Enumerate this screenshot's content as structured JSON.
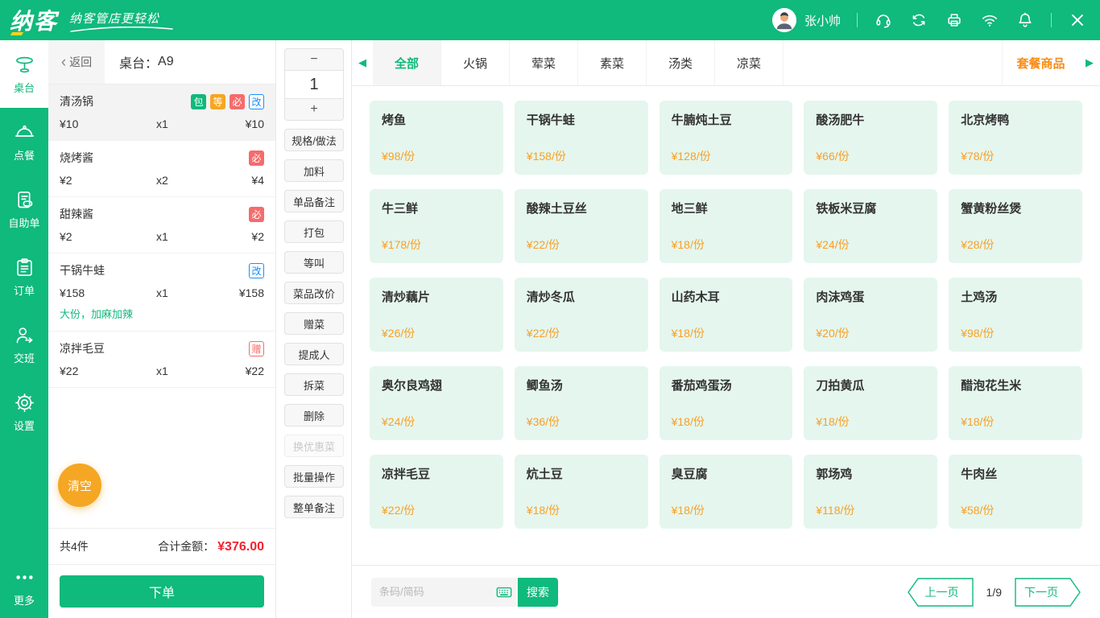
{
  "colors": {
    "theme_green": "#10b97c",
    "accent_orange": "#f5a623",
    "price_orange": "#f9a026",
    "danger_red": "#f5222d",
    "combo_orange": "#fa8c16",
    "badge_blue": "#1890ff",
    "badge_red": "#f56c6c"
  },
  "topbar": {
    "logo": "纳客",
    "slogan": "纳客管店更轻松",
    "user": "张小帅",
    "icons": [
      "avatar",
      "headset-icon",
      "sync-icon",
      "printer-icon",
      "wifi-icon",
      "bell-icon",
      "close-icon"
    ]
  },
  "sidebar": {
    "items": [
      {
        "label": "桌台",
        "icon": "table-icon",
        "active": true
      },
      {
        "label": "点餐",
        "icon": "cloche-icon"
      },
      {
        "label": "自助单",
        "icon": "self-order-icon"
      },
      {
        "label": "订单",
        "icon": "clipboard-icon"
      },
      {
        "label": "交班",
        "icon": "shift-person-icon"
      },
      {
        "label": "设置",
        "icon": "gear-icon"
      }
    ],
    "more": "更多"
  },
  "order": {
    "back": "返回",
    "table_prefix": "桌台：",
    "table_no": "A9",
    "items": [
      {
        "name": "清汤锅",
        "price": "¥10",
        "qty": "x1",
        "total": "¥10",
        "badges": [
          "包",
          "等",
          "必",
          "改"
        ],
        "selected": true
      },
      {
        "name": "烧烤酱",
        "price": "¥2",
        "qty": "x2",
        "total": "¥4",
        "badges": [
          "必"
        ]
      },
      {
        "name": "甜辣酱",
        "price": "¥2",
        "qty": "x1",
        "total": "¥2",
        "badges": [
          "必"
        ]
      },
      {
        "name": "干锅牛蛙",
        "price": "¥158",
        "qty": "x1",
        "total": "¥158",
        "badges": [
          "改"
        ],
        "note": "大份，加麻加辣"
      },
      {
        "name": "凉拌毛豆",
        "price": "¥22",
        "qty": "x1",
        "total": "¥22",
        "badges": [
          "赠"
        ]
      }
    ],
    "clear": "清空",
    "count": "共4件",
    "total_label": "合计金额：",
    "total_value": "¥376.00",
    "submit": "下单"
  },
  "actions": {
    "minus": "−",
    "qty": "1",
    "plus": "+",
    "buttons": [
      {
        "label": "规格/做法"
      },
      {
        "label": "加料"
      },
      {
        "label": "单品备注"
      },
      {
        "label": "打包"
      },
      {
        "label": "等叫"
      },
      {
        "label": "菜品改价"
      },
      {
        "label": "赠菜"
      },
      {
        "label": "提成人"
      },
      {
        "label": "拆菜"
      },
      {
        "label": "删除"
      },
      {
        "label": "换优惠菜",
        "disabled": true
      },
      {
        "label": "批量操作"
      },
      {
        "label": "整单备注"
      }
    ]
  },
  "categories": {
    "tabs": [
      {
        "label": "全部",
        "active": true
      },
      {
        "label": "火锅"
      },
      {
        "label": "荤菜"
      },
      {
        "label": "素菜"
      },
      {
        "label": "汤类"
      },
      {
        "label": "凉菜"
      }
    ],
    "combo": "套餐商品"
  },
  "menu": {
    "items": [
      {
        "name": "烤鱼",
        "price": "¥98/份"
      },
      {
        "name": "干锅牛蛙",
        "price": "¥158/份"
      },
      {
        "name": "牛腩炖土豆",
        "price": "¥128/份"
      },
      {
        "name": "酸汤肥牛",
        "price": "¥66/份"
      },
      {
        "name": "北京烤鸭",
        "price": "¥78/份"
      },
      {
        "name": "牛三鲜",
        "price": "¥178/份"
      },
      {
        "name": "酸辣土豆丝",
        "price": "¥22/份"
      },
      {
        "name": "地三鲜",
        "price": "¥18/份"
      },
      {
        "name": "铁板米豆腐",
        "price": "¥24/份"
      },
      {
        "name": "蟹黄粉丝煲",
        "price": "¥28/份"
      },
      {
        "name": "清炒藕片",
        "price": "¥26/份"
      },
      {
        "name": "清炒冬瓜",
        "price": "¥22/份"
      },
      {
        "name": "山药木耳",
        "price": "¥18/份"
      },
      {
        "name": "肉沫鸡蛋",
        "price": "¥20/份"
      },
      {
        "name": "土鸡汤",
        "price": "¥98/份"
      },
      {
        "name": "奥尔良鸡翅",
        "price": "¥24/份"
      },
      {
        "name": "鲫鱼汤",
        "price": "¥36/份"
      },
      {
        "name": "番茄鸡蛋汤",
        "price": "¥18/份"
      },
      {
        "name": "刀拍黄瓜",
        "price": "¥18/份"
      },
      {
        "name": "醋泡花生米",
        "price": "¥18/份"
      },
      {
        "name": "凉拌毛豆",
        "price": "¥22/份"
      },
      {
        "name": "炕土豆",
        "price": "¥18/份"
      },
      {
        "name": "臭豆腐",
        "price": "¥18/份"
      },
      {
        "name": "郭场鸡",
        "price": "¥118/份"
      },
      {
        "name": "牛肉丝",
        "price": "¥58/份"
      }
    ]
  },
  "search": {
    "placeholder": "条码/简码",
    "button": "搜索"
  },
  "pagination": {
    "prev": "上一页",
    "page": "1/9",
    "next": "下一页"
  }
}
